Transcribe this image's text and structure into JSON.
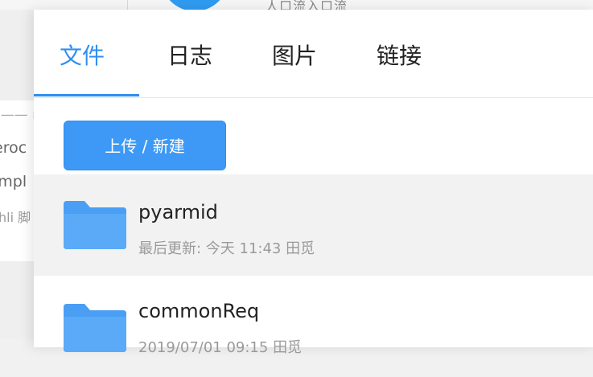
{
  "tabs": [
    {
      "label": "文件",
      "active": true
    },
    {
      "label": "日志",
      "active": false
    },
    {
      "label": "图片",
      "active": false
    },
    {
      "label": "链接",
      "active": false
    }
  ],
  "toolbar": {
    "upload_label": "上传 / 新建"
  },
  "files": [
    {
      "name": "pyarmid",
      "meta": "最后更新: 今天 11:43  田觅",
      "icon": "folder-icon",
      "selected": true
    },
    {
      "name": "commonReq",
      "meta": "2019/07/01 09:15  田觅",
      "icon": "folder-icon",
      "selected": false
    }
  ],
  "background": {
    "top_text": "人口流入口流",
    "lines": [
      "“—— m",
      "eroc",
      "impl",
      "hli 脚"
    ]
  },
  "colors": {
    "accent": "#2f8ff0",
    "folder": "#4a9ff5",
    "selected_row": "#f2f2f2"
  }
}
